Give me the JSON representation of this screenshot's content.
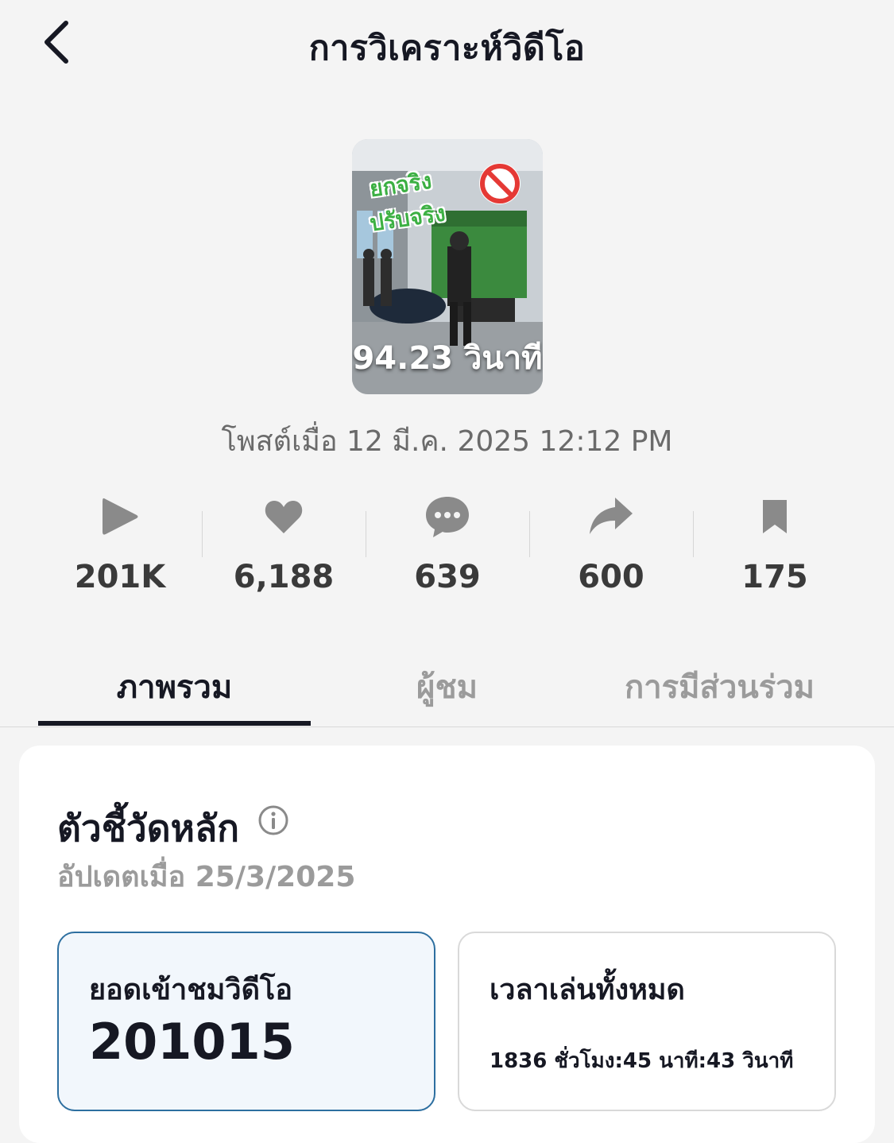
{
  "header": {
    "title": "การวิเคราะห์วิดีโอ"
  },
  "video": {
    "duration": "94.23 วินาที",
    "overlay_line1": "ยกจริง",
    "overlay_line2": "ปรับจริง",
    "posted": "โพสต์เมื่อ 12 มี.ค. 2025 12:12 PM"
  },
  "stats": [
    {
      "icon": "play-icon",
      "value": "201K"
    },
    {
      "icon": "heart-icon",
      "value": "6,188"
    },
    {
      "icon": "comment-icon",
      "value": "639"
    },
    {
      "icon": "share-icon",
      "value": "600"
    },
    {
      "icon": "bookmark-icon",
      "value": "175"
    }
  ],
  "tabs": [
    {
      "label": "ภาพรวม",
      "active": true
    },
    {
      "label": "ผู้ชม",
      "active": false
    },
    {
      "label": "การมีส่วนร่วม",
      "active": false
    }
  ],
  "key_metrics": {
    "title": "ตัวชี้วัดหลัก",
    "updated": "อัปเดตเมื่อ 25/3/2025",
    "cards": [
      {
        "label": "ยอดเข้าชมวิดีโอ",
        "value": "201015"
      },
      {
        "label": "เวลาเล่นทั้งหมด",
        "value": "1836 ชั่วโมง:45 นาที:43 วินาที"
      }
    ]
  },
  "colors": {
    "background": "#f4f4f4",
    "text_primary": "#161823",
    "text_muted": "#9b9b9b",
    "icon_gray": "#8a8a8a",
    "selected_border": "#2d6fa0",
    "selected_fill": "#f2f7fc"
  }
}
